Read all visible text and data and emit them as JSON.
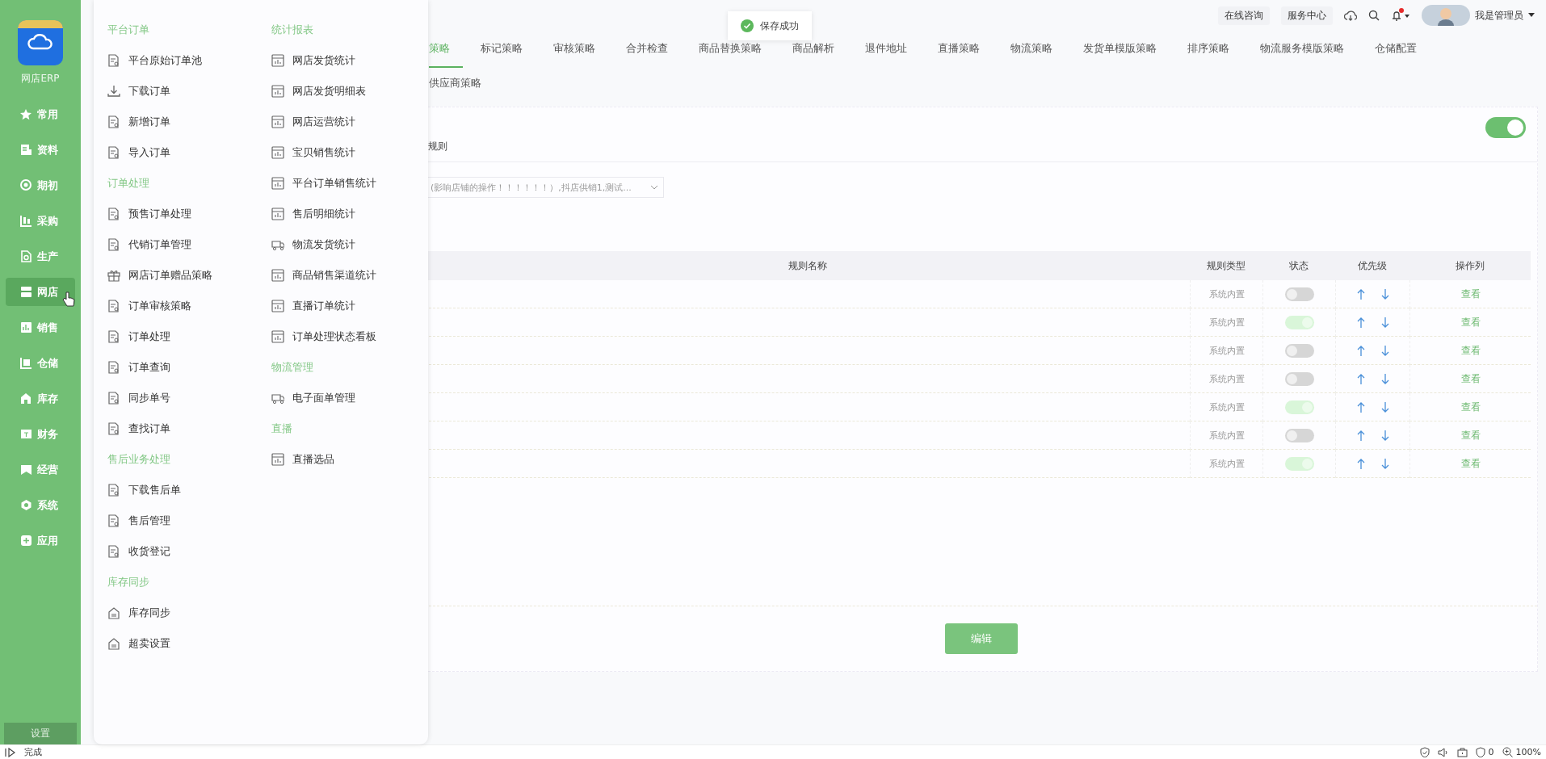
{
  "sidebar": {
    "logo_text": "网店ERP",
    "items": [
      {
        "label": "常用",
        "selected": false
      },
      {
        "label": "资料",
        "selected": false
      },
      {
        "label": "期初",
        "selected": false
      },
      {
        "label": "采购",
        "selected": false
      },
      {
        "label": "生产",
        "selected": false
      },
      {
        "label": "网店",
        "selected": true
      },
      {
        "label": "销售",
        "selected": false
      },
      {
        "label": "仓储",
        "selected": false
      },
      {
        "label": "库存",
        "selected": false
      },
      {
        "label": "财务",
        "selected": false
      },
      {
        "label": "经营",
        "selected": false
      },
      {
        "label": "系统",
        "selected": false
      },
      {
        "label": "应用",
        "selected": false
      }
    ],
    "footer": "设置"
  },
  "menu": {
    "columns": [
      [
        {
          "title": "平台订单",
          "items": [
            "平台原始订单池",
            "下载订单",
            "新增订单",
            "导入订单"
          ]
        },
        {
          "title": "订单处理",
          "items": [
            "预售订单处理",
            "代销订单管理",
            "网店订单赠品策略",
            "订单审核策略",
            "订单处理",
            "订单查询",
            "同步单号",
            "查找订单"
          ]
        },
        {
          "title": "售后业务处理",
          "items": [
            "下载售后单",
            "售后管理",
            "收货登记"
          ]
        },
        {
          "title": "库存同步",
          "items": [
            "库存同步",
            "超卖设置"
          ]
        }
      ],
      [
        {
          "title": "统计报表",
          "items": [
            "网店发货统计",
            "网店发货明细表",
            "网店运营统计",
            "宝贝销售统计",
            "平台订单销售统计",
            "售后明细统计",
            "物流发货统计",
            "商品销售渠道统计",
            "直播订单统计",
            "订单处理状态看板"
          ]
        },
        {
          "title": "物流管理",
          "items": [
            "电子面单管理"
          ]
        },
        {
          "title": "直播",
          "items": [
            "直播选品"
          ]
        }
      ]
    ]
  },
  "topbar": {
    "links": [
      "在线咨询",
      "服务中心"
    ],
    "has_unread": true,
    "user": "我是管理员"
  },
  "toast": "保存成功",
  "tabs": [
    [
      {
        "label": "策略",
        "selected": true
      },
      {
        "label": "标记策略",
        "selected": false
      },
      {
        "label": "审核策略",
        "selected": false
      },
      {
        "label": "合并检查",
        "selected": false
      },
      {
        "label": "商品替换策略",
        "selected": false
      },
      {
        "label": "商品解析",
        "selected": false
      },
      {
        "label": "退件地址",
        "selected": false
      },
      {
        "label": "直播策略",
        "selected": false
      },
      {
        "label": "物流策略",
        "selected": false
      },
      {
        "label": "发货单模版策略",
        "selected": false
      },
      {
        "label": "排序策略",
        "selected": false
      },
      {
        "label": "物流服务模版策略",
        "selected": false
      },
      {
        "label": "仓储配置",
        "selected": false
      }
    ],
    [
      {
        "label": "供应商策略",
        "selected": false
      }
    ]
  ],
  "panel": {
    "enabled": true,
    "label": "规则",
    "shop_select": "(影响店铺的操作！！！！！！）,抖店供销1,测试...",
    "table": {
      "columns": [
        "规则名称",
        "规则类型",
        "状态",
        "优先级",
        "操作列"
      ],
      "rows": [
        {
          "type": "系统内置",
          "on": false,
          "action": "查看"
        },
        {
          "type": "系统内置",
          "on": true,
          "action": "查看"
        },
        {
          "type": "系统内置",
          "on": false,
          "action": "查看"
        },
        {
          "type": "系统内置",
          "on": false,
          "action": "查看"
        },
        {
          "type": "系统内置",
          "on": true,
          "action": "查看"
        },
        {
          "type": "系统内置",
          "on": false,
          "action": "查看"
        },
        {
          "type": "系统内置",
          "on": true,
          "action": "查看"
        }
      ]
    },
    "button": "编辑"
  },
  "status_bar": {
    "text": "完成",
    "count": "0",
    "zoom": "100%"
  }
}
